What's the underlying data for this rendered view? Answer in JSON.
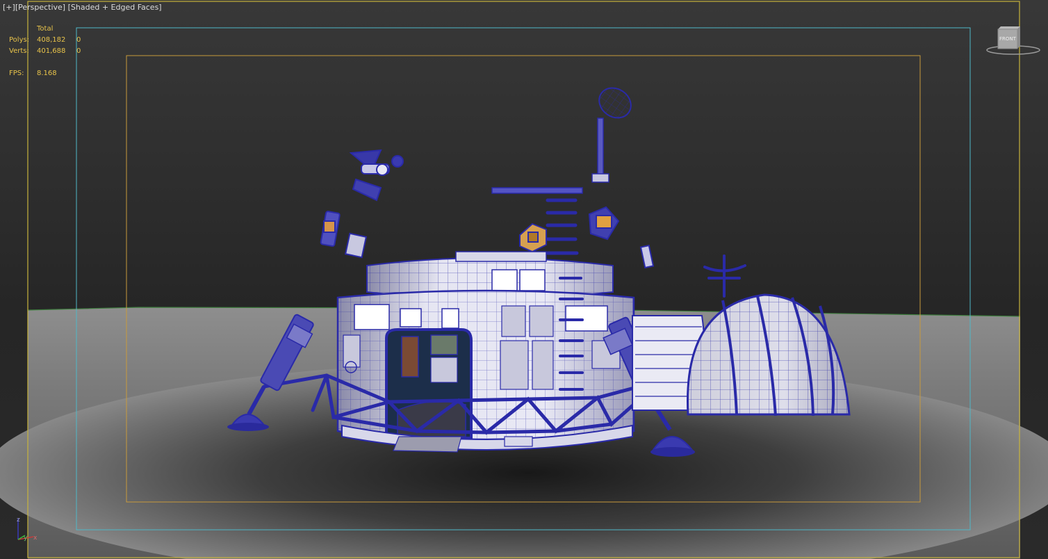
{
  "viewport": {
    "label_plus": "[+]",
    "label_view": "[Perspective]",
    "label_shading": "[Shaded + Edged Faces]"
  },
  "stats": {
    "header": "Total",
    "polys_label": "Polys:",
    "polys_total": "408,182",
    "polys_selected": "0",
    "verts_label": "Verts:",
    "verts_total": "401,688",
    "verts_selected": "0",
    "fps_label": "FPS:",
    "fps_value": "8.168"
  },
  "viewcube": {
    "face_label": "FRONT",
    "icon": "viewcube-icon"
  },
  "axis": {
    "z": "z",
    "y": "y",
    "x": "x"
  },
  "colors": {
    "outer_frame": "#c8b43c",
    "safe_frame_action": "#4fb8c8",
    "safe_frame_title": "#c89a3c",
    "wireframe": "#2a2aa8",
    "model_fill": "#dcdcec",
    "stats_text": "#e8c34a"
  }
}
